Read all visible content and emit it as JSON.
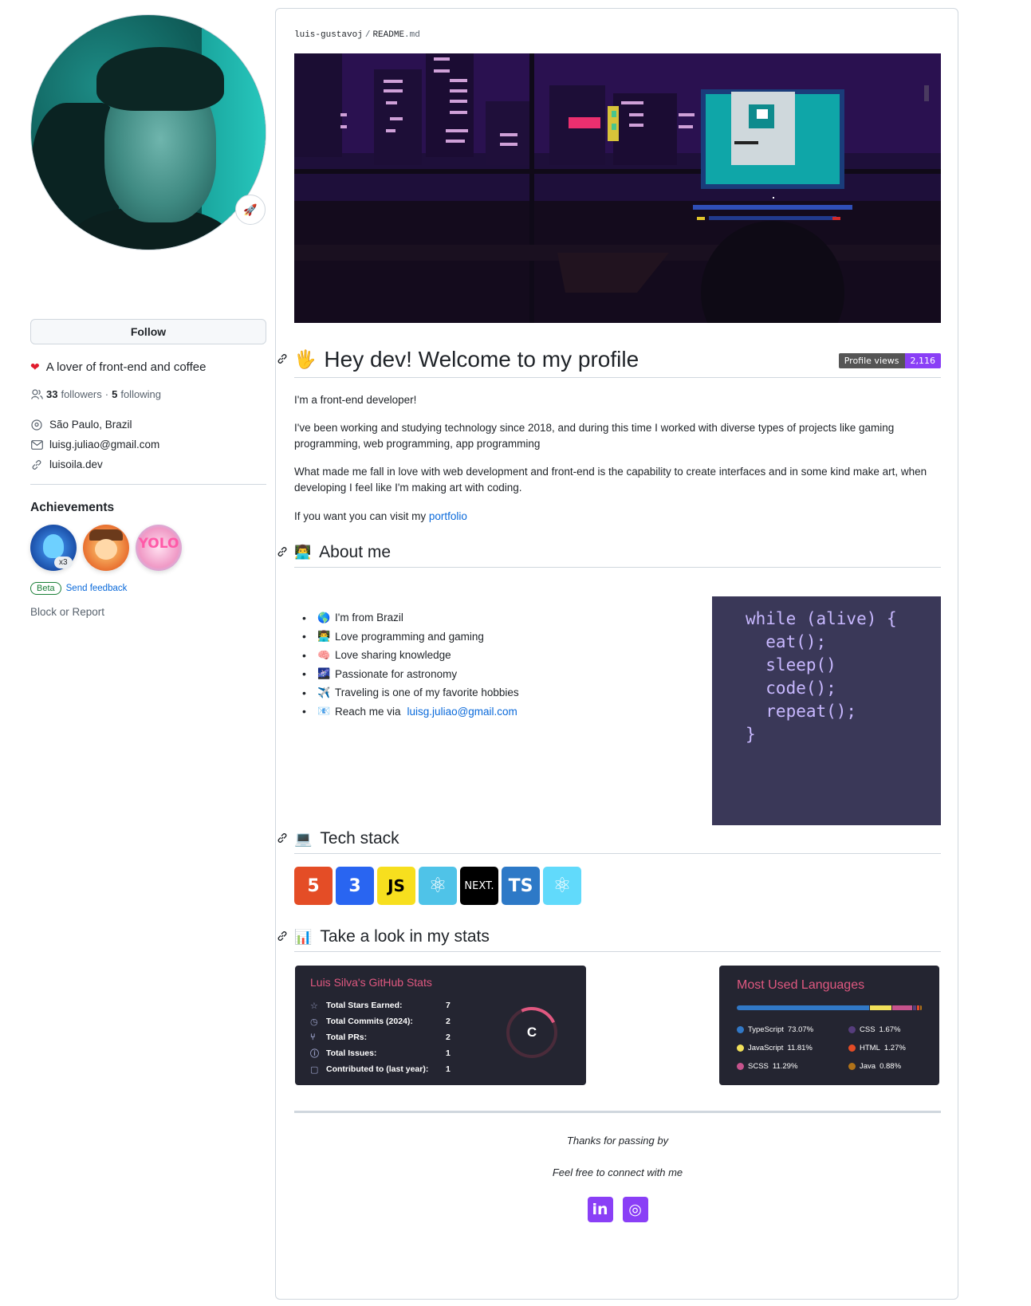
{
  "profile": {
    "status_emoji": "🚀",
    "follow_label": "Follow",
    "bio": "A lover of front-end and coffee",
    "followers_count": "33",
    "followers_label": "followers",
    "separator": "·",
    "following_count": "5",
    "following_label": "following",
    "location": "São Paulo, Brazil",
    "email": "luisg.juliao@gmail.com",
    "website": "luisoila.dev",
    "achievements_title": "Achievements",
    "achievement_multiplier": "x3",
    "achievement_yolo": "YOLO",
    "beta_label": "Beta",
    "feedback_label": "Send feedback",
    "block_report": "Block or Report"
  },
  "readme": {
    "owner": "luis-gustavoj",
    "slash": "/",
    "file": "README",
    "ext": ".md",
    "heading_welcome": "Hey dev! Welcome to my profile",
    "heading_welcome_emoji": "🖐",
    "views_label": "Profile views",
    "views_count": "2,116",
    "intro_1": "I'm a front-end developer!",
    "intro_2": "I've been working and studying technology since 2018, and during this time I worked with diverse types of projects like gaming programming, web programming, app programming",
    "intro_3": "What made me fall in love with web development and front-end is the capability to create interfaces and in some kind make art, when developing I feel like I'm making art with coding.",
    "intro_4_prefix": "If you want you can visit my",
    "intro_4_link": "portfolio",
    "heading_about": "About me",
    "heading_about_emoji": "👨‍💻",
    "about_items": [
      {
        "emoji": "🌎",
        "text": "I'm from Brazil"
      },
      {
        "emoji": "👨‍💻",
        "text": "Love programming and gaming"
      },
      {
        "emoji": "🧠",
        "text": "Love sharing knowledge"
      },
      {
        "emoji": "🌌",
        "text": "Passionate for astronomy"
      },
      {
        "emoji": "✈️",
        "text": "Traveling is one of my favorite hobbies"
      },
      {
        "emoji": "📧",
        "text": "Reach me via",
        "link": "luisg.juliao@gmail.com"
      }
    ],
    "code": "while (alive) {\n  eat();\n  sleep()\n  code();\n  repeat();\n}",
    "heading_stack": "Tech stack",
    "heading_stack_emoji": "💻",
    "tech": [
      "5",
      "3",
      "JS",
      "⚛",
      "NEXT.",
      "TS",
      "⚛"
    ],
    "heading_stats": "Take a look in my stats",
    "heading_stats_emoji": "📊",
    "footer_thanks": "Thanks for passing by",
    "footer_connect": "Feel free to connect with me",
    "social": [
      "in",
      "◎"
    ]
  },
  "stats_card": {
    "title": "Luis Silva's GitHub Stats",
    "rows": [
      {
        "icon": "☆",
        "label": "Total Stars Earned:",
        "value": "7"
      },
      {
        "icon": "◷",
        "label": "Total Commits (2024):",
        "value": "2"
      },
      {
        "icon": "⑂",
        "label": "Total PRs:",
        "value": "2"
      },
      {
        "icon": "ⓘ",
        "label": "Total Issues:",
        "value": "1"
      },
      {
        "icon": "▢",
        "label": "Contributed to (last year):",
        "value": "1"
      }
    ],
    "rank": "C"
  },
  "lang_card": {
    "title": "Most Used Languages",
    "languages": [
      {
        "name": "TypeScript",
        "percent": "73.07%",
        "value": 73.07,
        "color": "#3178c6"
      },
      {
        "name": "CSS",
        "percent": "1.67%",
        "value": 1.67,
        "color": "#563d7c"
      },
      {
        "name": "JavaScript",
        "percent": "11.81%",
        "value": 11.81,
        "color": "#f1e05a"
      },
      {
        "name": "HTML",
        "percent": "1.27%",
        "value": 1.27,
        "color": "#e34c26"
      },
      {
        "name": "SCSS",
        "percent": "11.29%",
        "value": 11.29,
        "color": "#c6538c"
      },
      {
        "name": "Java",
        "percent": "0.88%",
        "value": 0.88,
        "color": "#b07219"
      }
    ]
  },
  "colors": {
    "accent": "#8a3ff6",
    "link": "#0969da",
    "card_bg": "#242531",
    "card_title": "#e05880"
  }
}
